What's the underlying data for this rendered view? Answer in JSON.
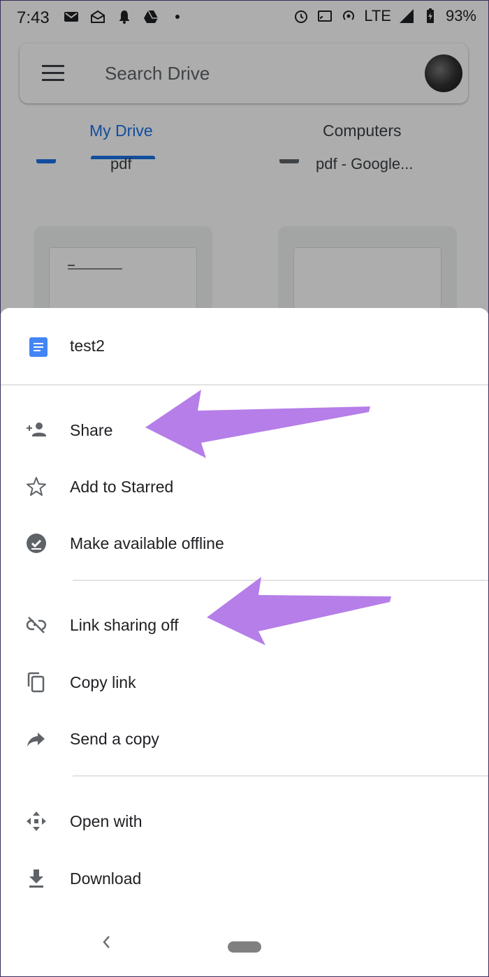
{
  "status_bar": {
    "time": "7:43",
    "network": "LTE",
    "battery": "93%"
  },
  "search": {
    "placeholder": "Search Drive"
  },
  "tabs": [
    {
      "label": "My Drive",
      "selected": true
    },
    {
      "label": "Computers",
      "selected": false
    }
  ],
  "background_files": [
    {
      "name": "pdf"
    },
    {
      "name": "pdf - Google..."
    }
  ],
  "sheet": {
    "title": "test2",
    "groups": [
      [
        {
          "label": "Share",
          "icon": "person-add-icon"
        },
        {
          "label": "Add to Starred",
          "icon": "star-outline-icon"
        },
        {
          "label": "Make available offline",
          "icon": "offline-check-icon"
        }
      ],
      [
        {
          "label": "Link sharing off",
          "icon": "link-off-icon"
        },
        {
          "label": "Copy link",
          "icon": "copy-icon"
        },
        {
          "label": "Send a copy",
          "icon": "forward-arrow-icon"
        }
      ],
      [
        {
          "label": "Open with",
          "icon": "open-with-icon"
        },
        {
          "label": "Download",
          "icon": "download-icon"
        }
      ]
    ]
  },
  "annotations": {
    "arrow_color": "#b57ee8"
  },
  "colors": {
    "accent": "#1a73e8",
    "doc_icon": "#4285f4"
  }
}
